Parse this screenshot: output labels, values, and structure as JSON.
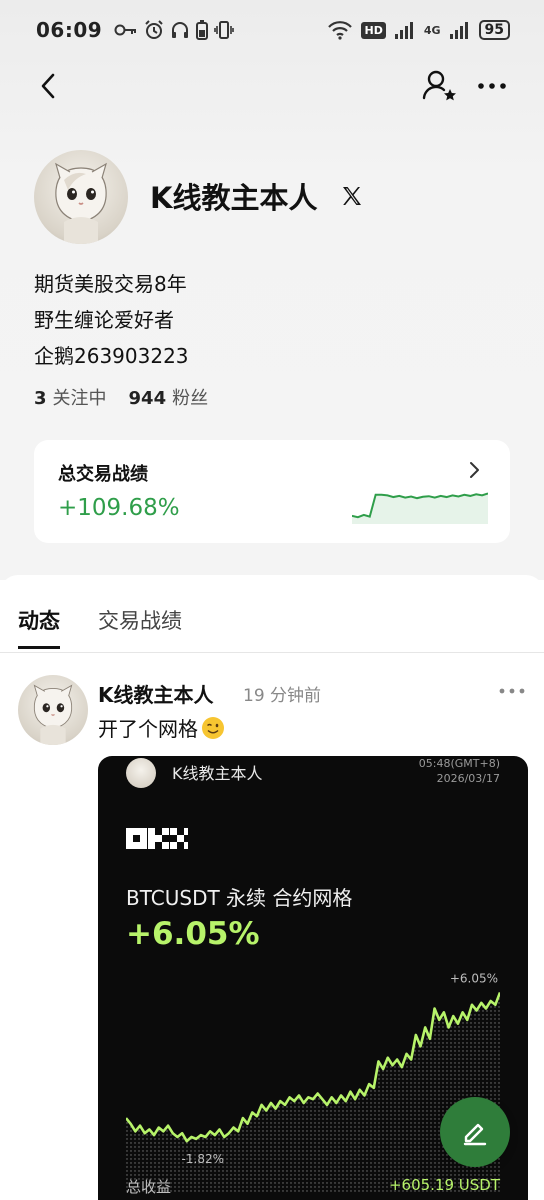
{
  "status_bar": {
    "time": "06:09",
    "battery": "95",
    "network": "4G",
    "hd": "HD"
  },
  "profile": {
    "name": "K线教主本人",
    "bio": [
      "期货美股交易8年",
      "野生缠论爱好者",
      "企鹅263903223"
    ],
    "following_count": "3",
    "following_label": "关注中",
    "followers_count": "944",
    "followers_label": "粉丝"
  },
  "performance": {
    "title": "总交易战绩",
    "value": "+109.68%",
    "accent_color": "#2f9e4a",
    "sparkline": [
      0.15,
      0.1,
      0.18,
      0.12,
      0.9,
      0.9,
      0.88,
      0.82,
      0.86,
      0.8,
      0.84,
      0.78,
      0.83,
      0.85,
      0.8,
      0.86,
      0.82,
      0.88,
      0.84,
      0.9,
      0.86,
      0.92,
      0.88,
      0.95
    ]
  },
  "tabs": [
    {
      "label": "动态",
      "active": true
    },
    {
      "label": "交易战绩",
      "active": false
    }
  ],
  "post": {
    "author": "K线教主本人",
    "time": "19 分钟前",
    "text": "开了个网格",
    "card": {
      "author": "K线教主本人",
      "time_line1": "05:48(GMT+8)",
      "time_line2": "2026/03/17",
      "pair": "BTCUSDT 永续 合约网格",
      "pnl": "+6.05%",
      "max_label": "+6.05%",
      "min_label": "-1.82%",
      "footer_label": "总收益",
      "footer_value": "+605.19 USDT",
      "accent_color": "#b7f36a"
    }
  },
  "chart_data": {
    "type": "area",
    "title": "",
    "xlabel": "",
    "ylabel": "",
    "ylim": [
      -2.5,
      6.5
    ],
    "max_label": "+6.05%",
    "min_label": "-1.82%",
    "series": [
      {
        "values": [
          -0.6,
          -0.9,
          -1.3,
          -1.0,
          -1.4,
          -1.2,
          -1.5,
          -1.1,
          -1.3,
          -1.0,
          -1.4,
          -1.6,
          -1.4,
          -1.82,
          -1.6,
          -1.7,
          -1.5,
          -1.6,
          -1.3,
          -1.5,
          -1.2,
          -1.6,
          -1.4,
          -1.1,
          -1.3,
          -0.6,
          -0.9,
          -0.3,
          -0.5,
          0.1,
          -0.2,
          0.2,
          -0.1,
          0.3,
          0.1,
          0.5,
          0.3,
          0.6,
          0.2,
          0.5,
          0.4,
          0.7,
          0.4,
          0.1,
          0.5,
          0.2,
          0.6,
          0.3,
          0.8,
          0.4,
          0.9,
          0.6,
          1.2,
          1.0,
          2.4,
          2.0,
          2.6,
          2.2,
          2.5,
          2.1,
          2.8,
          2.5,
          3.8,
          3.2,
          4.2,
          3.6,
          5.2,
          4.6,
          5.0,
          4.2,
          4.8,
          4.4,
          5.0,
          4.6,
          5.4,
          5.1,
          5.5,
          5.2,
          5.6,
          5.4,
          6.05
        ]
      }
    ]
  },
  "fab": {
    "icon": "edit-icon"
  }
}
